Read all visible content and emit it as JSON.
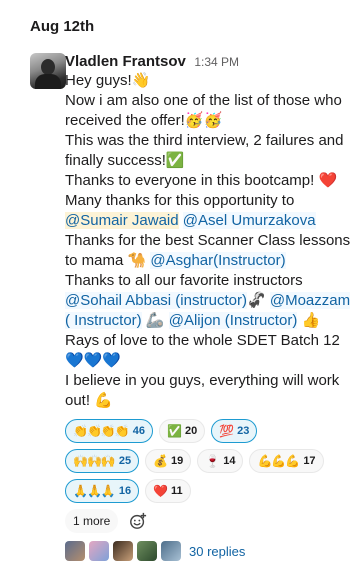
{
  "date_label": "Aug 12th",
  "message": {
    "sender": "Vladlen Frantsov",
    "time": "1:34 PM",
    "lines": {
      "l1": "Hey guys!👋",
      "l2": "Now i am also one of the list of those who received the offer!🥳🥳",
      "l3": "This was the third interview, 2 failures and finally success!✅",
      "l4": "Thanks to everyone in this bootcamp! ❤️",
      "l5_pre": "Many thanks for this opportunity to ",
      "l5_m1": "@Sumair Jawaid",
      "l5_m2": "@Asel Umurzakova",
      "l6_pre": "Thanks for the best Scanner Class lessons to mama 🐪 ",
      "l6_m1": "@Asghar(Instructor)",
      "l7_pre": "Thanks to all our favorite instructors ",
      "l7_m1": "@Sohail Abbasi (instructor)",
      "l7_mid": "🦨 ",
      "l7_m2": "@Moazzam ( Instructor)",
      "l7_pre2": "🦾 ",
      "l7_m3": "@Alijon (Instructor)",
      "l7_end": " 👍",
      "l8": "Rays of love to the whole SDET Batch 12💙💙💙",
      "l9": "I believe in you guys, everything will work out! 💪"
    },
    "reactions": [
      {
        "emoji": "👏👏👏👏",
        "count": "46",
        "active": true
      },
      {
        "emoji": "✅",
        "count": "20",
        "active": false
      },
      {
        "emoji": "💯",
        "count": "23",
        "active": true
      },
      {
        "emoji": "🙌🙌🙌",
        "count": "25",
        "active": true
      },
      {
        "emoji": "💰",
        "count": "19",
        "active": false
      },
      {
        "emoji": "🍷",
        "count": "14",
        "active": false
      },
      {
        "emoji": "💪💪💪",
        "count": "17",
        "active": false
      },
      {
        "emoji": "🙏🙏🙏",
        "count": "16",
        "active": true
      },
      {
        "emoji": "❤️",
        "count": "11",
        "active": false
      }
    ],
    "more_label": "1 more",
    "add_reaction_icon": "emoji-add-icon",
    "replies_label": "30 replies"
  }
}
